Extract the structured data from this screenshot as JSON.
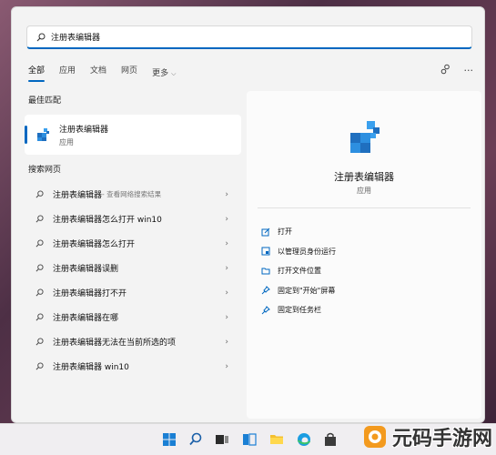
{
  "search": {
    "value": "注册表编辑器"
  },
  "tabs": [
    {
      "label": "全部",
      "active": true
    },
    {
      "label": "应用"
    },
    {
      "label": "文档"
    },
    {
      "label": "网页"
    },
    {
      "label": "更多"
    }
  ],
  "best_match": {
    "section_label": "最佳匹配",
    "name": "注册表编辑器",
    "type": "应用"
  },
  "web": {
    "section_label": "搜索网页",
    "items": [
      {
        "text": "注册表编辑器",
        "suffix": " - 查看网络搜索结果"
      },
      {
        "text": "注册表编辑器怎么打开 win10",
        "suffix": ""
      },
      {
        "text": "注册表编辑器怎么打开",
        "suffix": ""
      },
      {
        "text": "注册表编辑器误删",
        "suffix": ""
      },
      {
        "text": "注册表编辑器打不开",
        "suffix": ""
      },
      {
        "text": "注册表编辑器在哪",
        "suffix": ""
      },
      {
        "text": "注册表编辑器无法在当前所选的项",
        "suffix": ""
      },
      {
        "text": "注册表编辑器 win10",
        "suffix": ""
      }
    ]
  },
  "detail": {
    "name": "注册表编辑器",
    "type": "应用",
    "actions": [
      {
        "label": "打开",
        "icon": "open-icon"
      },
      {
        "label": "以管理员身份运行",
        "icon": "admin-shield-icon"
      },
      {
        "label": "打开文件位置",
        "icon": "folder-icon"
      },
      {
        "label": "固定到\"开始\"屏幕",
        "icon": "pin-icon"
      },
      {
        "label": "固定到任务栏",
        "icon": "pin-icon"
      }
    ]
  },
  "watermark": {
    "text": "元码手游网"
  },
  "colors": {
    "accent": "#0067c0",
    "panel": "#f3f3f3"
  }
}
